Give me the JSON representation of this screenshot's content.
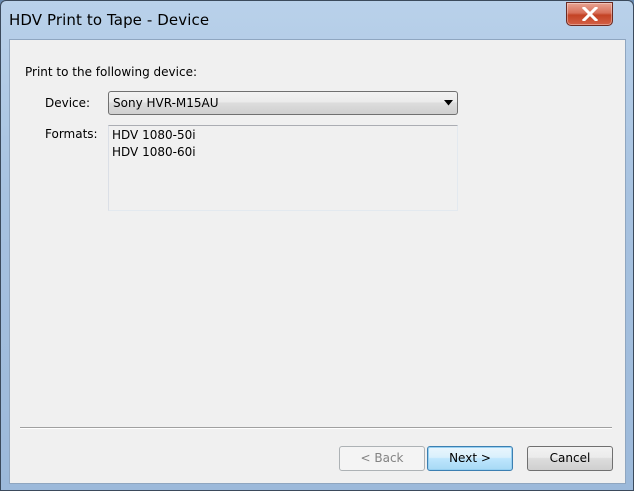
{
  "window": {
    "title": "HDV Print to Tape - Device",
    "close_glyph": "✕"
  },
  "content": {
    "heading": "Print to the following device:",
    "device_label": "Device:",
    "device_value": "Sony HVR-M15AU",
    "formats_label": "Formats:",
    "formats": [
      "HDV 1080-50i",
      "HDV 1080-60i"
    ]
  },
  "buttons": {
    "back": "< Back",
    "next": "Next >",
    "cancel": "Cancel"
  },
  "icons": {
    "close": "close-icon",
    "dropdown": "chevron-down-icon"
  },
  "colors": {
    "client_bg": "#f0f0f0",
    "close_red": "#c34325",
    "default_button_border": "#3c7fb1"
  }
}
